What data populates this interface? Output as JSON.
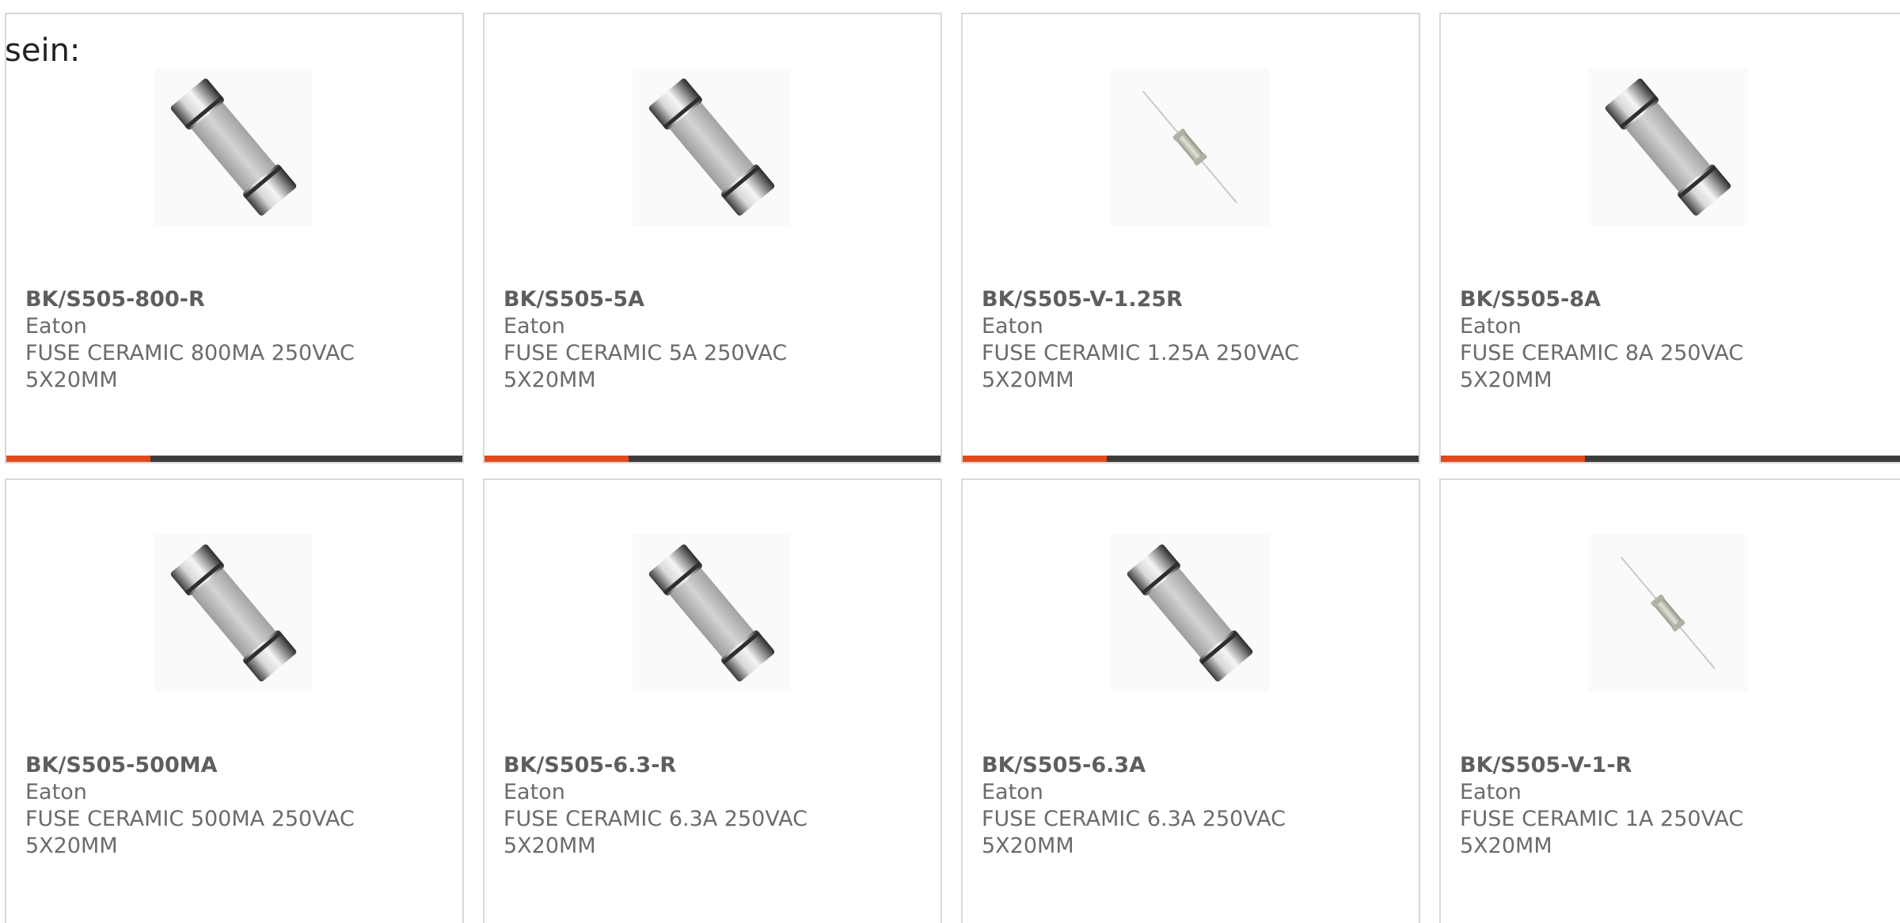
{
  "intro_text": "sein:",
  "colors": {
    "accent": "#e24a1c",
    "bar": "#3c3c3c",
    "border": "#d9d9d9",
    "text": "#6b6b6b"
  },
  "products": [
    {
      "part_number": "BK/S505-800-R",
      "manufacturer": "Eaton",
      "description": "FUSE CERAMIC 800MA 250VAC",
      "size": "5X20MM",
      "image": "cartridge-fuse-image"
    },
    {
      "part_number": "BK/S505-5A",
      "manufacturer": "Eaton",
      "description": "FUSE CERAMIC 5A 250VAC",
      "size": "5X20MM",
      "image": "cartridge-fuse-image"
    },
    {
      "part_number": "BK/S505-V-1.25R",
      "manufacturer": "Eaton",
      "description": "FUSE CERAMIC 1.25A 250VAC",
      "size": "5X20MM",
      "image": "axial-lead-fuse-image"
    },
    {
      "part_number": "BK/S505-8A",
      "manufacturer": "Eaton",
      "description": "FUSE CERAMIC 8A 250VAC",
      "size": "5X20MM",
      "image": "cartridge-fuse-image"
    },
    {
      "part_number": "BK/S505-500MA",
      "manufacturer": "Eaton",
      "description": "FUSE CERAMIC 500MA 250VAC",
      "size": "5X20MM",
      "image": "cartridge-fuse-image"
    },
    {
      "part_number": "BK/S505-6.3-R",
      "manufacturer": "Eaton",
      "description": "FUSE CERAMIC 6.3A 250VAC",
      "size": "5X20MM",
      "image": "cartridge-fuse-image"
    },
    {
      "part_number": "BK/S505-6.3A",
      "manufacturer": "Eaton",
      "description": "FUSE CERAMIC 6.3A 250VAC",
      "size": "5X20MM",
      "image": "cartridge-fuse-image"
    },
    {
      "part_number": "BK/S505-V-1-R",
      "manufacturer": "Eaton",
      "description": "FUSE CERAMIC 1A 250VAC",
      "size": "5X20MM",
      "image": "axial-lead-fuse-image"
    }
  ]
}
